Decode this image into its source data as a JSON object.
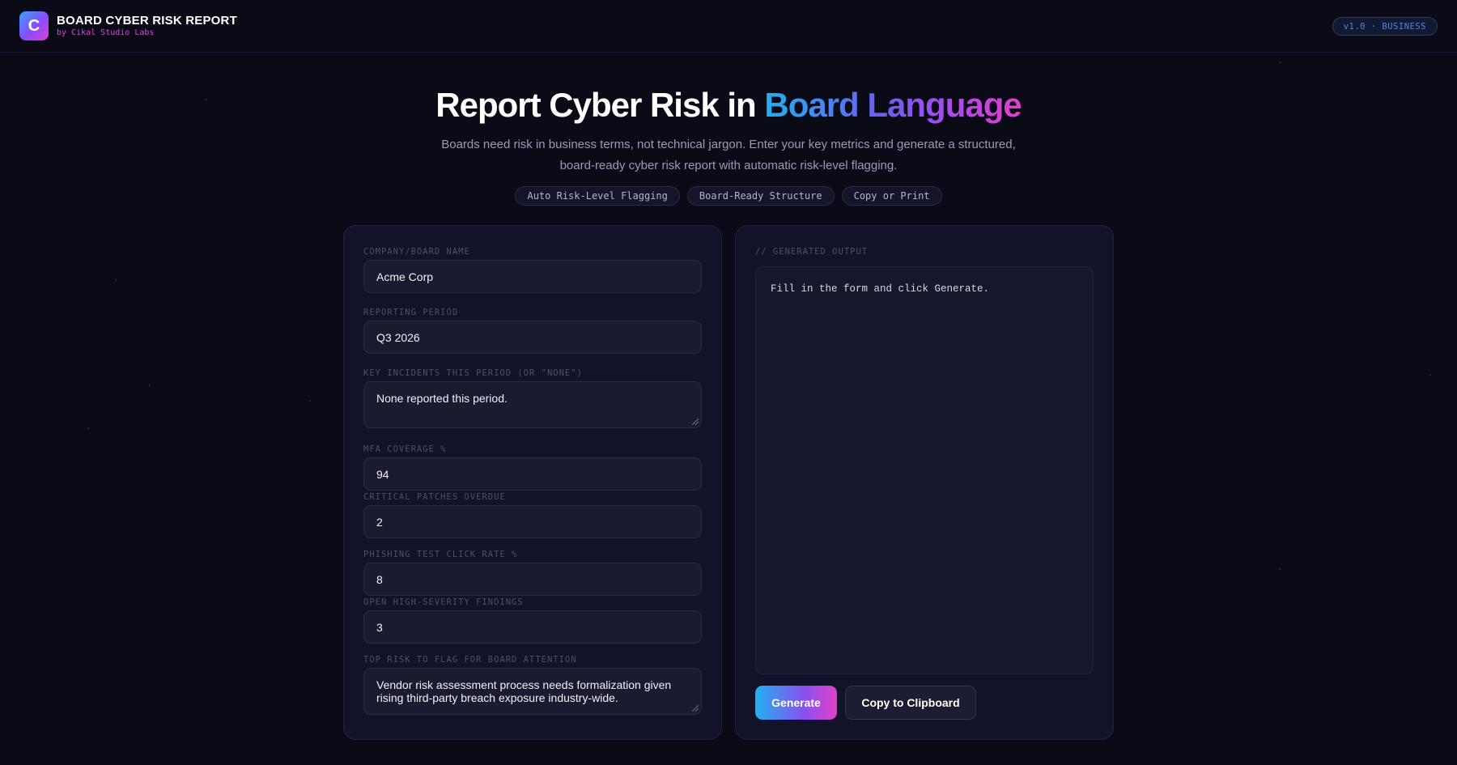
{
  "header": {
    "logo_letter": "C",
    "title": "BOARD CYBER RISK REPORT",
    "subtitle": "by Cikal Studio Labs",
    "version": "v1.0 · BUSINESS"
  },
  "hero": {
    "title_plain": "Report Cyber Risk in ",
    "title_highlight": "Board Language",
    "description_line1": "Boards need risk in business terms, not technical jargon. Enter your key metrics and generate a structured,",
    "description_line2": "board-ready cyber risk report with automatic risk-level flagging.",
    "chips": [
      "Auto Risk-Level Flagging",
      "Board-Ready Structure",
      "Copy or Print"
    ]
  },
  "form": {
    "company": {
      "label": "COMPANY/BOARD NAME",
      "value": "Acme Corp"
    },
    "period": {
      "label": "REPORTING PERIOD",
      "value": "Q3 2026"
    },
    "incidents": {
      "label": "KEY INCIDENTS THIS PERIOD (OR \"NONE\")",
      "value": "None reported this period."
    },
    "mfa": {
      "label": "MFA COVERAGE %",
      "value": "94"
    },
    "patches": {
      "label": "CRITICAL PATCHES OVERDUE",
      "value": "2"
    },
    "phishing": {
      "label": "PHISHING TEST CLICK RATE %",
      "value": "8"
    },
    "findings": {
      "label": "OPEN HIGH-SEVERITY FINDINGS",
      "value": "3"
    },
    "top_risk": {
      "label": "TOP RISK TO FLAG FOR BOARD ATTENTION",
      "value": "Vendor risk assessment process needs formalization given rising third-party breach exposure industry-wide."
    }
  },
  "output": {
    "label": "// GENERATED OUTPUT",
    "placeholder": "Fill in the form and click Generate.",
    "generate_label": "Generate",
    "copy_label": "Copy to Clipboard"
  },
  "colors": {
    "background": "#0b0b18",
    "panel": "#12122a",
    "accent_start": "#22b0f0",
    "accent_end": "#e040c8",
    "subtitle_pink": "#d04ad8",
    "version_blue": "#4a86e8"
  }
}
